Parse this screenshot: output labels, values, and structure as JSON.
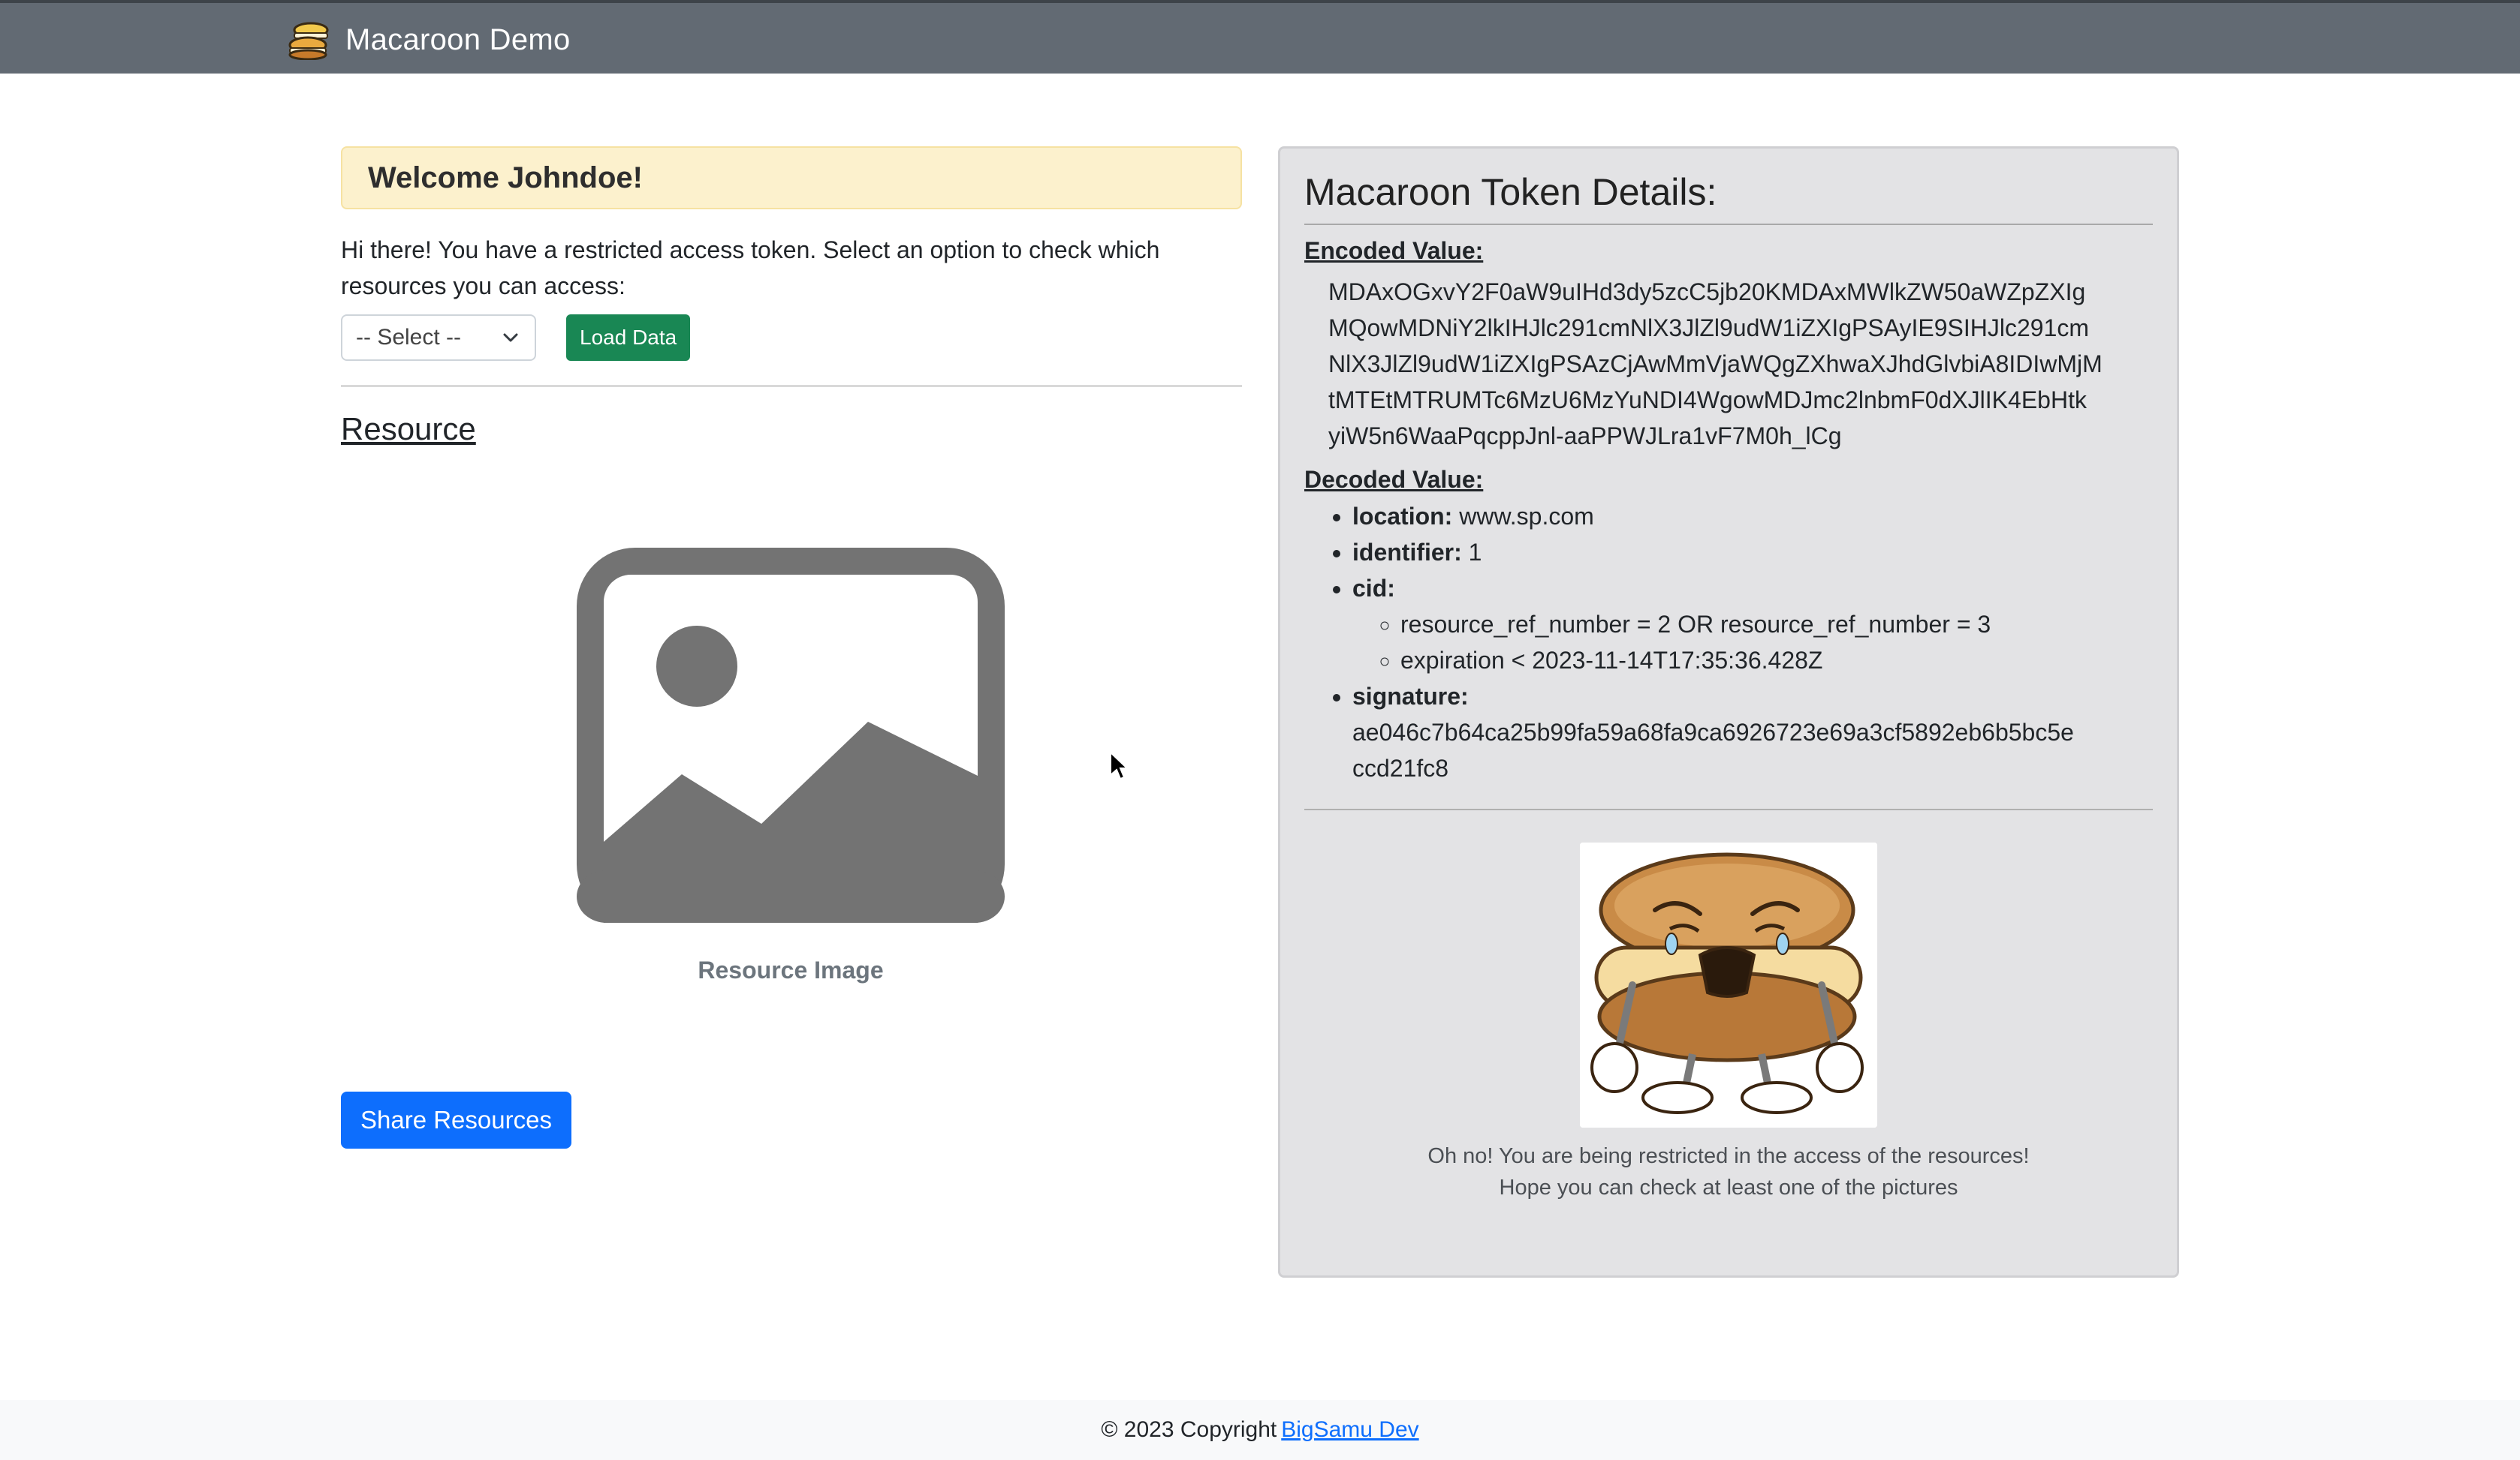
{
  "navbar": {
    "brand_icon": "macaroon-logo-icon",
    "title": "Macaroon Demo"
  },
  "left": {
    "welcome": "Welcome Johndoe!",
    "intro": "Hi there! You have a restricted access token. Select an option to check which resources you can access:",
    "select_value": "-- Select --",
    "load_button": "Load Data",
    "resource_title": "Resource",
    "placeholder_icon": "image-placeholder-icon",
    "image_caption": "Resource Image",
    "share_button": "Share Resources"
  },
  "panel": {
    "title": "Macaroon Token Details:",
    "encoded_label": "Encoded Value:",
    "encoded_lines": [
      "MDAxOGxvY2F0aW9uIHd3dy5zcC5jb20KMDAxMWlkZW50aWZpZXIg",
      "MQowMDNiY2lkIHJlc291cmNlX3JlZl9udW1iZXIgPSAyIE9SIHJlc291cm",
      "NlX3JlZl9udW1iZXIgPSAzCjAwMmVjaWQgZXhwaXJhdGlvbiA8IDIwMjM",
      "tMTEtMTRUMTc6MzU6MzYuNDI4WgowMDJmc2lnbmF0dXJlIK4EbHtk",
      "yiW5n6WaaPqcppJnl-aaPPWJLra1vF7M0h_lCg"
    ],
    "decoded_label": "Decoded Value:",
    "location_key": "location:",
    "location_value": "www.sp.com",
    "identifier_key": "identifier:",
    "identifier_value": "1",
    "cid_key": "cid:",
    "cid_items": [
      "resource_ref_number = 2 OR resource_ref_number = 3",
      "expiration < 2023-11-14T17:35:36.428Z"
    ],
    "signature_key": "signature:",
    "signature_lines": [
      "ae046c7b64ca25b99fa59a68fa9ca6926723e69a3cf5892eb6b5bc5e",
      "ccd21fc8"
    ],
    "mascot_icon": "crying-macaroon-image",
    "message_line1": "Oh no! You are being restricted in the access of the resources!",
    "message_line2": "Hope you can check at least one of the pictures"
  },
  "footer": {
    "copyright": "© 2023 Copyright",
    "link": "BigSamu Dev"
  },
  "colors": {
    "navbar": "#626a73",
    "success": "#198754",
    "primary": "#0d6efd",
    "warning_bg": "#fcf1cd",
    "panel_bg": "#e3e3e5"
  }
}
